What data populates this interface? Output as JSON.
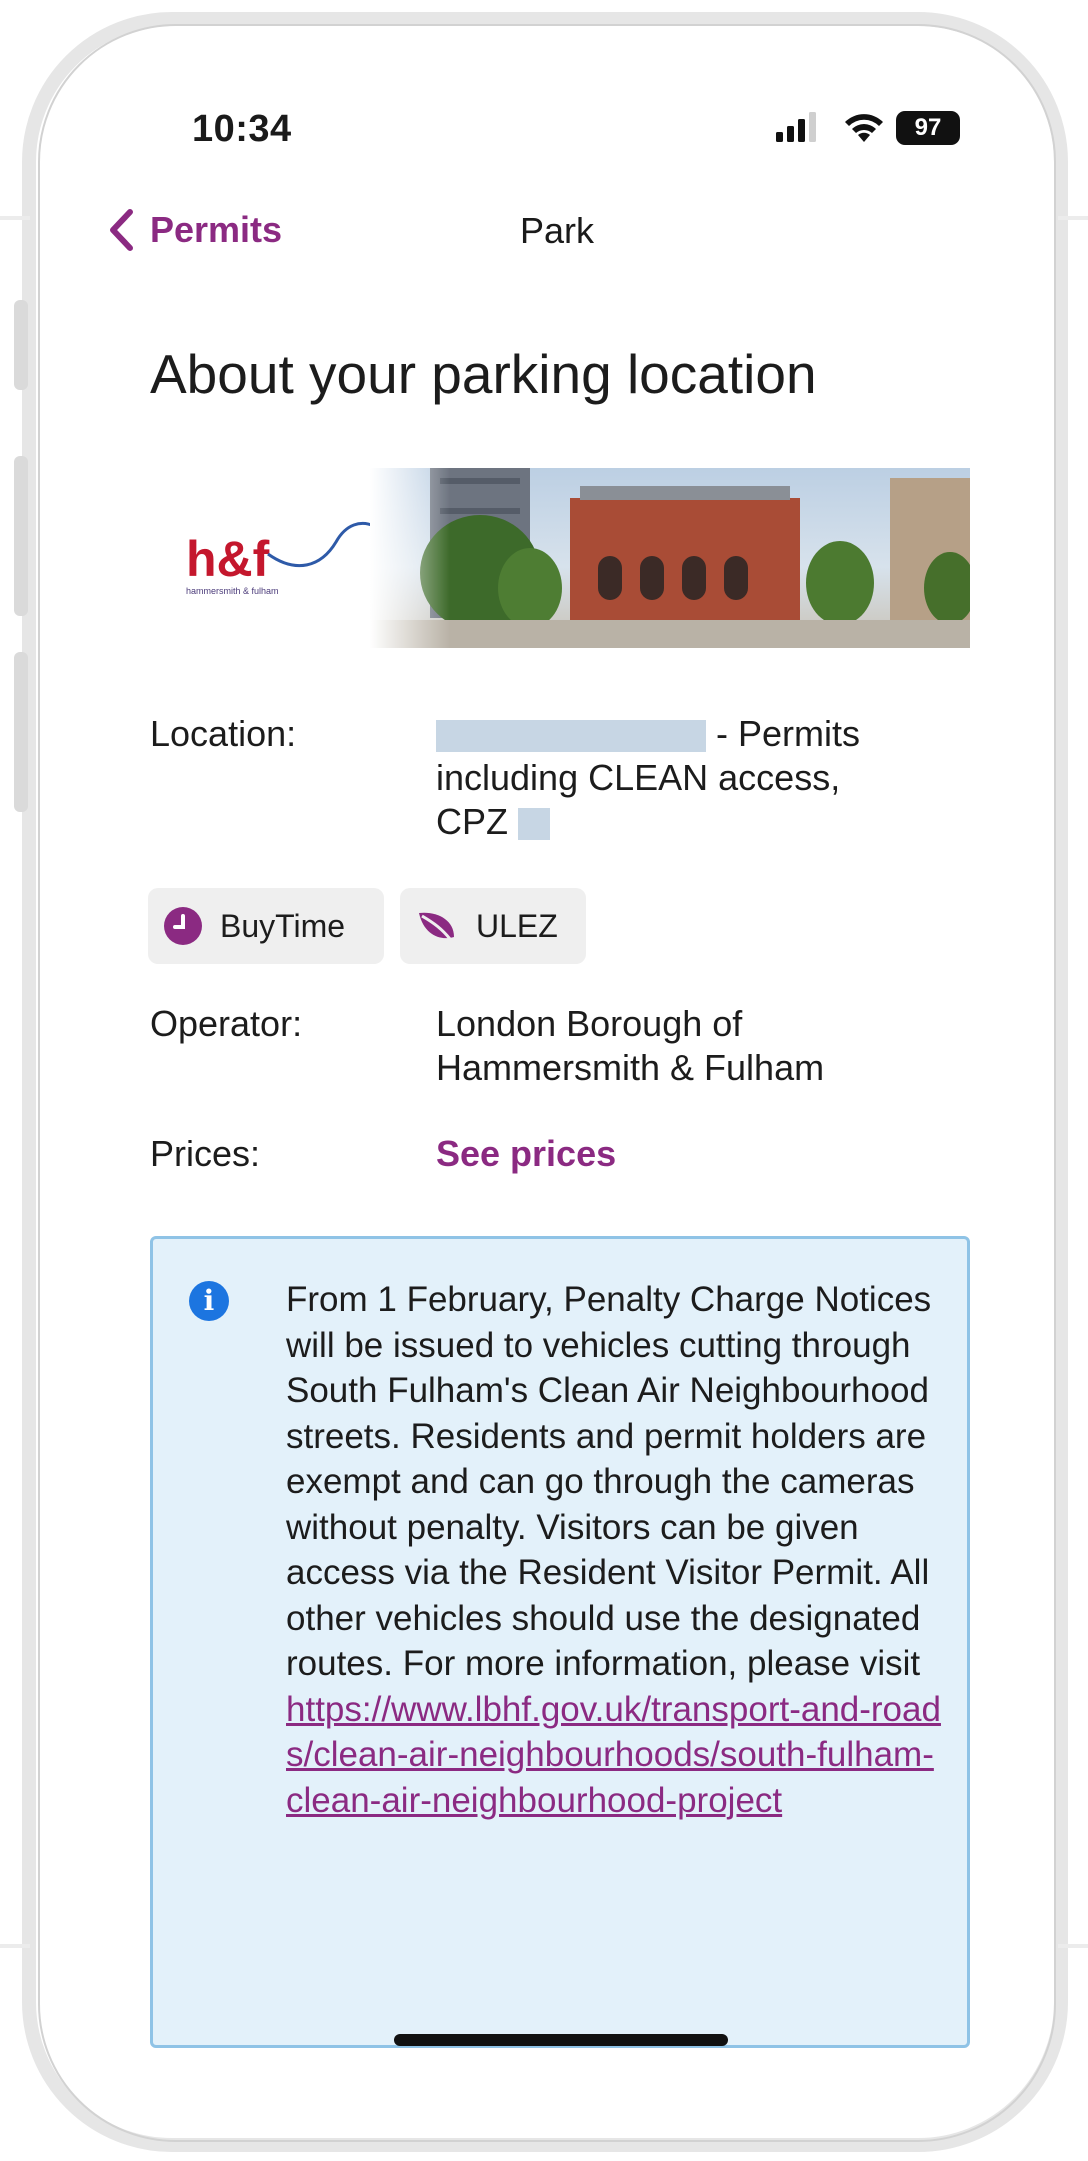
{
  "status": {
    "time": "10:34",
    "battery": "97"
  },
  "nav": {
    "back_label": "Permits",
    "title": "Park"
  },
  "page": {
    "title": "About your parking location"
  },
  "banner": {
    "logo_text": "h&f",
    "logo_sub": "hammersmith & fulham"
  },
  "location": {
    "label": "Location:",
    "value_after_redaction": " - Permits",
    "line2": "including CLEAN access,",
    "line3": "CPZ"
  },
  "chips": [
    {
      "label": "BuyTime",
      "icon": "clock-icon"
    },
    {
      "label": "ULEZ",
      "icon": "leaf-icon"
    }
  ],
  "operator": {
    "label": "Operator:",
    "line1": "London Borough of",
    "line2": "Hammersmith & Fulham"
  },
  "prices": {
    "label": "Prices:",
    "link": "See prices"
  },
  "info": {
    "text": "From 1 February, Penalty Charge Notices will be issued to vehicles cutting through South Fulham's Clean Air Neighbourhood streets. Residents and permit holders are exempt and can go through the cameras without penalty. Visitors can be given access via the Resident Visitor Permit. All other vehicles should use the designated routes. For more information, please visit",
    "link": "https://www.lbhf.gov.uk/transport-and-roads/clean-air-neighbourhoods/south-fulham-clean-air-neighbourhood-project"
  },
  "colors": {
    "brand": "#8b2a82",
    "info_bg": "#e3f1fa",
    "info_border": "#8fc3e6",
    "info_icon": "#1c75e0"
  }
}
